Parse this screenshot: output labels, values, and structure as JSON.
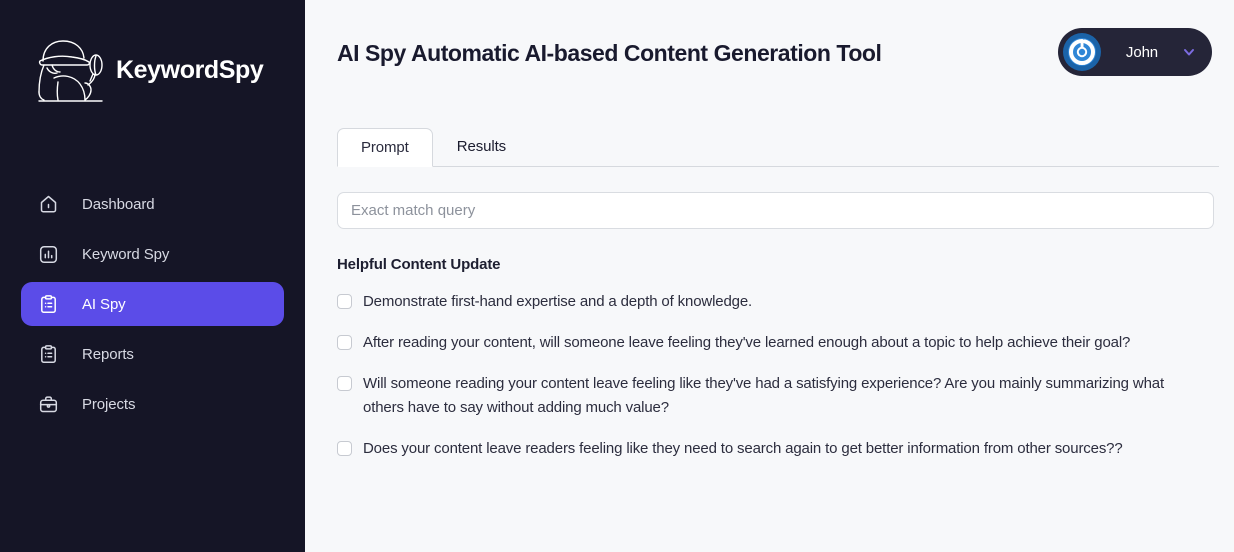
{
  "sidebar": {
    "brand": {
      "name": "KeywordSpy",
      "logo_icon": "spy-detective-magnifier-logo"
    },
    "items": [
      {
        "label": "Dashboard",
        "icon": "home-icon",
        "active": false
      },
      {
        "label": "Keyword Spy",
        "icon": "bar-chart-icon",
        "active": false
      },
      {
        "label": "AI Spy",
        "icon": "clipboard-list-icon",
        "active": true
      },
      {
        "label": "Reports",
        "icon": "clipboard-list-icon",
        "active": false
      },
      {
        "label": "Projects",
        "icon": "briefcase-icon",
        "active": false
      }
    ],
    "background_color": "#151526",
    "active_color": "#5b4ce8"
  },
  "header": {
    "title": "AI Spy Automatic AI-based Content Generation Tool",
    "user": {
      "name": "John",
      "avatar_icon": "power-spiral-avatar-icon",
      "chevron_icon": "chevron-down-icon",
      "chevron_color": "#7c6ce0",
      "pill_color": "#252538"
    }
  },
  "main": {
    "tabs": [
      {
        "label": "Prompt",
        "active": true
      },
      {
        "label": "Results",
        "active": false
      }
    ],
    "search": {
      "placeholder": "Exact match query",
      "value": ""
    },
    "section_title": "Helpful Content Update",
    "checklist": [
      {
        "label": "Demonstrate first-hand expertise and a depth of knowledge.",
        "checked": false
      },
      {
        "label": "After reading your content, will someone leave feeling they've learned enough about a topic to help achieve their goal?",
        "checked": false
      },
      {
        "label": "Will someone reading your content leave feeling like they've had a satisfying experience? Are you mainly summarizing what others have to say without adding much value?",
        "checked": false
      },
      {
        "label": "Does your content leave readers feeling like they need to search again to get better information from other sources??",
        "checked": false
      }
    ]
  }
}
